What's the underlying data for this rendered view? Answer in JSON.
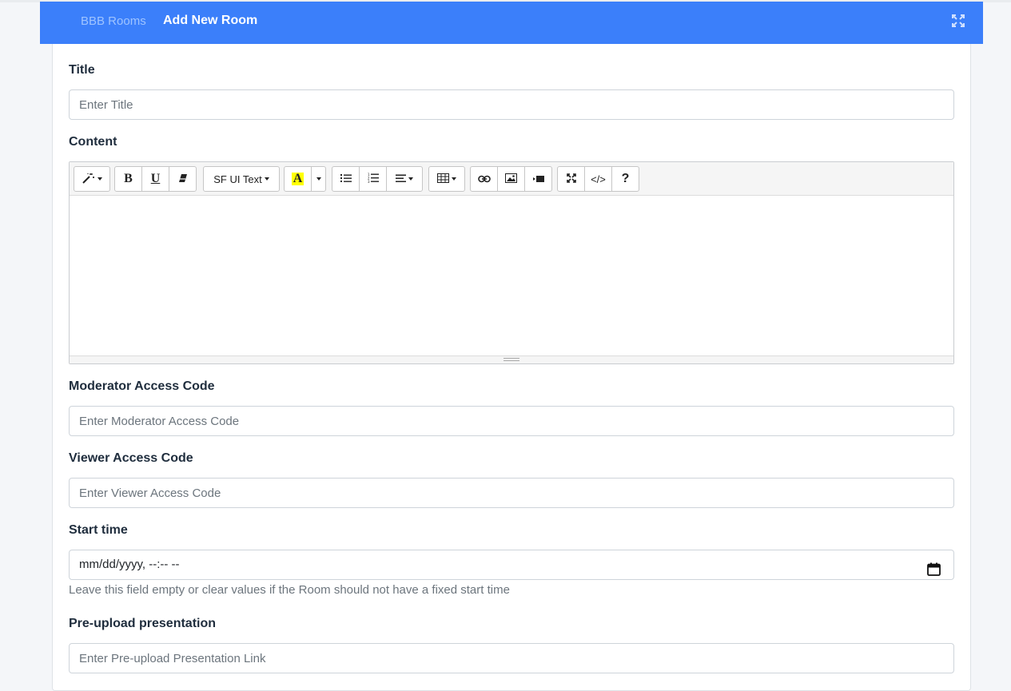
{
  "header": {
    "breadcrumb_parent": "BBB Rooms",
    "title": "Add New Room",
    "expand_icon": "expand-icon",
    "color": "#3b7ffa"
  },
  "form": {
    "title": {
      "label": "Title",
      "placeholder": "Enter Title"
    },
    "content": {
      "label": "Content",
      "toolbar": {
        "style": "magic-wand-icon",
        "bold": "B",
        "underline": "U",
        "clear": "eraser-icon",
        "font": "SF UI Text",
        "color": "A",
        "list_ul": "unordered-list-icon",
        "list_ol": "ordered-list-icon",
        "paragraph": "align-icon",
        "table": "table-icon",
        "link": "link-icon",
        "picture": "image-icon",
        "video": "video-icon",
        "fullscreen": "fullscreen-icon",
        "code": "</>",
        "help": "?"
      }
    },
    "moderator_code": {
      "label": "Moderator Access Code",
      "placeholder": "Enter Moderator Access Code"
    },
    "viewer_code": {
      "label": "Viewer Access Code",
      "placeholder": "Enter Viewer Access Code"
    },
    "start_time": {
      "label": "Start time",
      "placeholder": "mm/dd/yyyy, --:-- --",
      "help": "Leave this field empty or clear values if the Room should not have a fixed start time"
    },
    "presentation": {
      "label": "Pre-upload presentation",
      "placeholder": "Enter Pre-upload Presentation Link"
    }
  }
}
